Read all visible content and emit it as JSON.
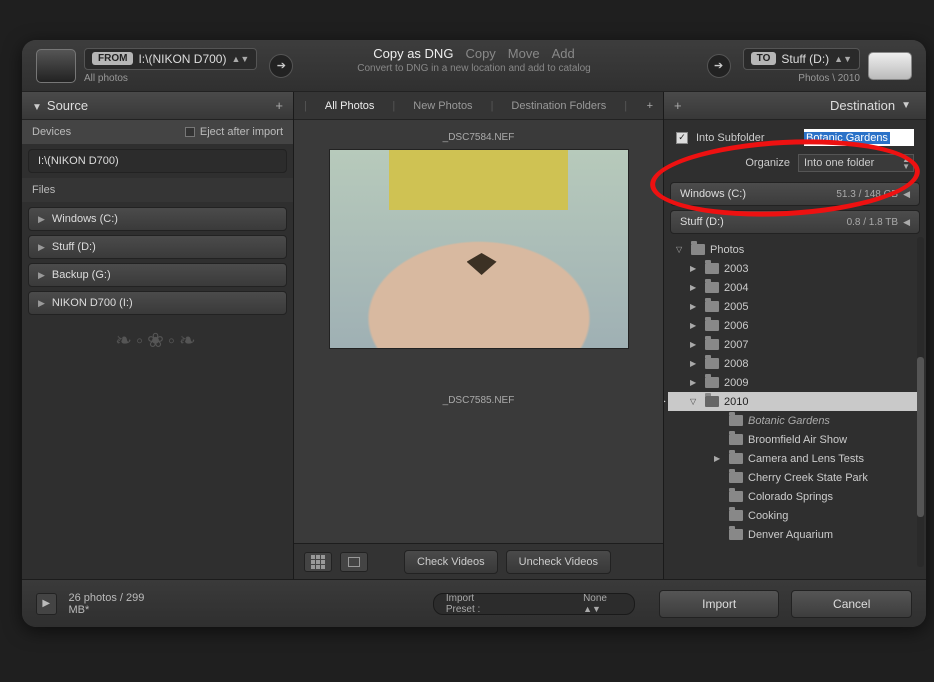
{
  "header": {
    "from_badge": "FROM",
    "from_path": "I:\\(NIKON D700)",
    "from_sub": "All photos",
    "to_badge": "TO",
    "to_path": "Stuff (D:)",
    "to_sub": "Photos \\ 2010",
    "mode_active": "Copy as DNG",
    "mode_copy": "Copy",
    "mode_move": "Move",
    "mode_add": "Add",
    "subtitle": "Convert to DNG in a new location and add to catalog"
  },
  "source_panel": {
    "title": "Source",
    "devices_label": "Devices",
    "eject_label": "Eject after import",
    "device": "I:\\(NIKON D700)",
    "files_label": "Files",
    "volumes": [
      "Windows (C:)",
      "Stuff (D:)",
      "Backup (G:)",
      "NIKON D700 (I:)"
    ]
  },
  "center": {
    "tabs": {
      "all": "All Photos",
      "new": "New Photos",
      "dest": "Destination Folders"
    },
    "thumbs": [
      "_DSC7584.NEF",
      "_DSC7585.NEF"
    ],
    "check_videos": "Check Videos",
    "uncheck_videos": "Uncheck Videos"
  },
  "destination": {
    "title": "Destination",
    "into_subfolder_label": "Into Subfolder",
    "subfolder_value": "Botanic Gardens",
    "organize_label": "Organize",
    "organize_value": "Into one folder",
    "drives": [
      {
        "name": "Windows (C:)",
        "stat": "51.3 / 148 GB"
      },
      {
        "name": "Stuff (D:)",
        "stat": "0.8 / 1.8 TB"
      }
    ],
    "tree": [
      {
        "depth": 0,
        "label": "Photos",
        "expanded": true
      },
      {
        "depth": 1,
        "label": "2003"
      },
      {
        "depth": 1,
        "label": "2004"
      },
      {
        "depth": 1,
        "label": "2005"
      },
      {
        "depth": 1,
        "label": "2006"
      },
      {
        "depth": 1,
        "label": "2007"
      },
      {
        "depth": 1,
        "label": "2008"
      },
      {
        "depth": 1,
        "label": "2009"
      },
      {
        "depth": 1,
        "label": "2010",
        "expanded": true,
        "selected": true
      },
      {
        "depth": 2,
        "label": "Botanic Gardens",
        "italic": true,
        "newfolder": true
      },
      {
        "depth": 2,
        "label": "Broomfield Air Show"
      },
      {
        "depth": 2,
        "label": "Camera and Lens Tests",
        "hasArrow": true
      },
      {
        "depth": 2,
        "label": "Cherry Creek State Park"
      },
      {
        "depth": 2,
        "label": "Colorado Springs"
      },
      {
        "depth": 2,
        "label": "Cooking"
      },
      {
        "depth": 2,
        "label": "Denver Aquarium"
      }
    ]
  },
  "footer": {
    "count": "26 photos / 299 MB*",
    "preset_label": "Import Preset :",
    "preset_value": "None",
    "import": "Import",
    "cancel": "Cancel"
  }
}
